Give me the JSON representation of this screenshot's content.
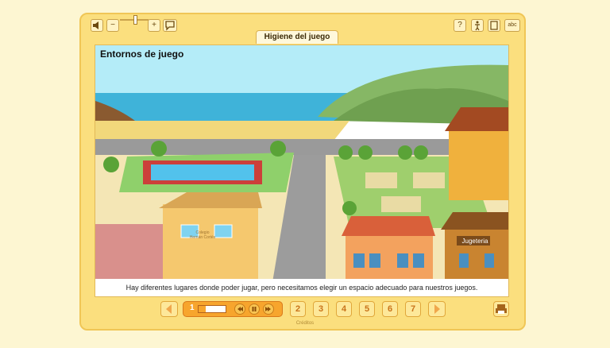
{
  "toolbar": {
    "left_icons": [
      "speaker-icon",
      "minus-icon",
      "plus-icon",
      "speech-bubble-icon"
    ],
    "right_icons": [
      "help-icon",
      "accessibility-icon",
      "document-icon",
      "abc-icon"
    ],
    "minus_glyph": "−",
    "plus_glyph": "+",
    "help_glyph": "?",
    "abc_glyph": "abc"
  },
  "header": {
    "title": "Higiene del juego"
  },
  "stage": {
    "title": "Entornos de juego",
    "caption": "Hay diferentes lugares donde poder jugar, pero necesitamos elegir un espacio adecuado para nuestros juegos.",
    "signs": {
      "school": "Colegio Hernán Cortés",
      "toy_store": "Jugeteria"
    }
  },
  "navigation": {
    "current_page": "1",
    "progress": 0.25,
    "pages": [
      "2",
      "3",
      "4",
      "5",
      "6",
      "7"
    ]
  },
  "footer": {
    "credits": "Créditos"
  },
  "colors": {
    "accent": "#f7a52d",
    "frame": "#fbdf7e",
    "page_text": "#c9731a"
  }
}
